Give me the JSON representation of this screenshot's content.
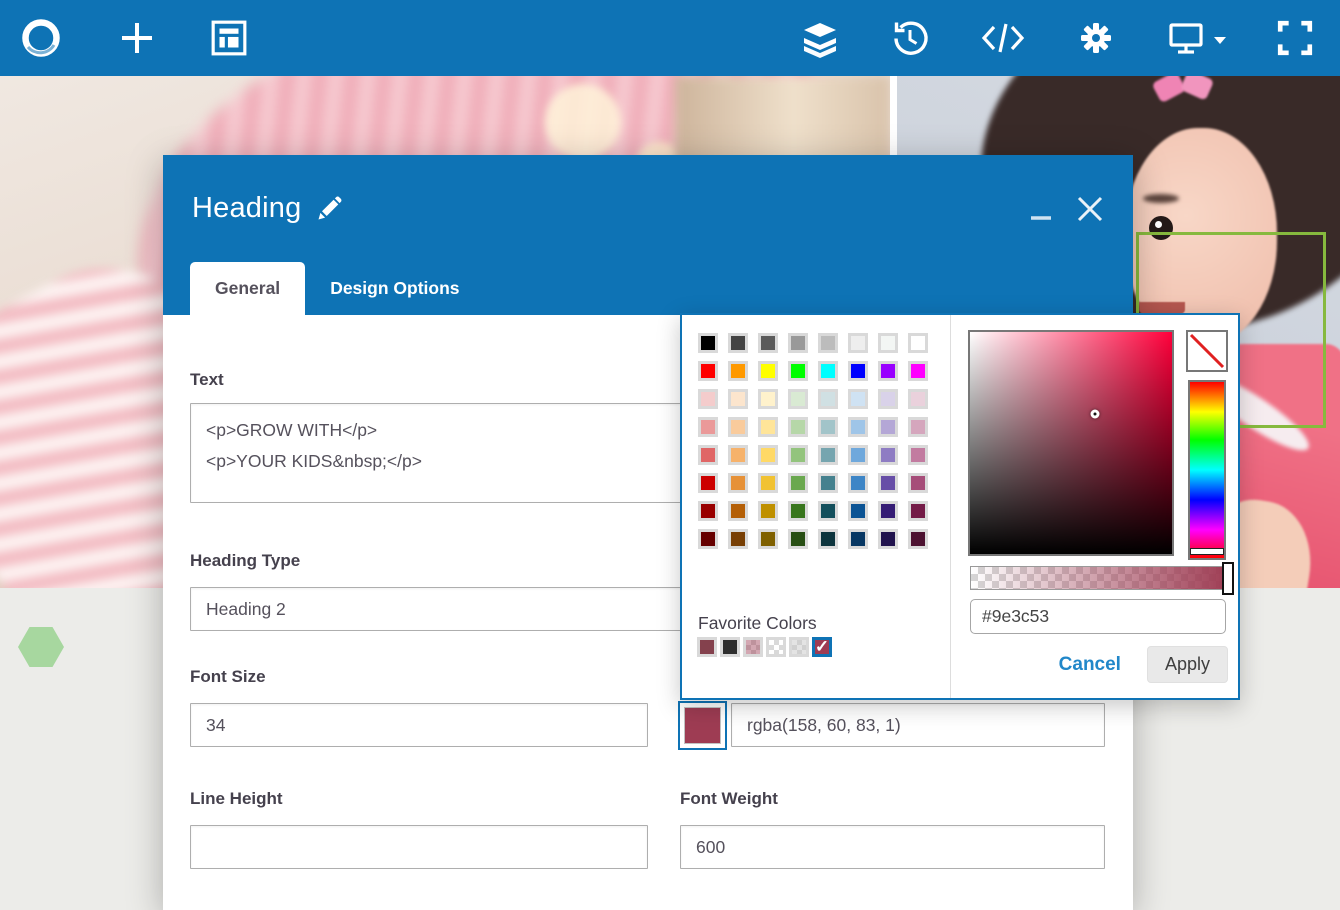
{
  "colors": {
    "toolbar-blue": "#0e73b5",
    "accent-maroon": "#9e3c53",
    "selection-green": "#86b93e",
    "hexagon-green": "#a7d79f",
    "page-gray": "#ecece9",
    "cancel-blue": "#2187c9"
  },
  "modal": {
    "title": "Heading",
    "tabs": [
      {
        "label": "General",
        "active": true
      },
      {
        "label": "Design Options",
        "active": false
      }
    ],
    "fields": {
      "text": {
        "label": "Text",
        "value": "<p>GROW WITH</p>\n<p>YOUR KIDS&nbsp;</p>"
      },
      "heading_type": {
        "label": "Heading Type",
        "value": "Heading 2"
      },
      "font_size": {
        "label": "Font Size",
        "value": "34"
      },
      "font_color": {
        "value": "rgba(158, 60, 83, 1)",
        "swatch": "#9e3c53"
      },
      "line_height": {
        "label": "Line Height",
        "value": ""
      },
      "font_weight": {
        "label": "Font Weight",
        "value": "600"
      }
    }
  },
  "picker": {
    "palette": [
      [
        "#000000",
        "#444444",
        "#5b5b5b",
        "#999999",
        "#bcbcbc",
        "#eeeeee",
        "#f3f6f4",
        "#ffffff"
      ],
      [
        "#ff0000",
        "#ff9900",
        "#ffff00",
        "#00ff00",
        "#00ffff",
        "#0000ff",
        "#9900ff",
        "#ff00ff"
      ],
      [
        "#f4cccc",
        "#fce5cd",
        "#fff2cc",
        "#d9ead3",
        "#d0e0e3",
        "#cfe2f3",
        "#d9d2e9",
        "#ead1dc"
      ],
      [
        "#ea9999",
        "#f9cb9c",
        "#ffe599",
        "#b6d7a8",
        "#a2c4c9",
        "#9fc5e8",
        "#b4a7d6",
        "#d5a6bd"
      ],
      [
        "#e06666",
        "#f6b26b",
        "#ffd966",
        "#93c47d",
        "#76a5af",
        "#6fa8dc",
        "#8e7cc3",
        "#c27ba0"
      ],
      [
        "#cc0000",
        "#e69138",
        "#f1c232",
        "#6aa84f",
        "#45818e",
        "#3d85c6",
        "#674ea7",
        "#a64d79"
      ],
      [
        "#990000",
        "#b45f06",
        "#bf9000",
        "#38761d",
        "#134f5c",
        "#0b5394",
        "#351c75",
        "#741b47"
      ],
      [
        "#660000",
        "#783f04",
        "#7f6000",
        "#274e13",
        "#0c343d",
        "#073763",
        "#20124d",
        "#4c1130"
      ]
    ],
    "favorites_label": "Favorite Colors",
    "favorites": [
      "#84414d",
      "#2e2e2e",
      "rgba(158,60,83,0.45)",
      "rgba(0,0,0,0)",
      "rgba(200,200,200,0.5)",
      "#9e3c53"
    ],
    "favorites_selected": 5,
    "hex_value": "#9e3c53",
    "cancel_label": "Cancel",
    "apply_label": "Apply"
  }
}
